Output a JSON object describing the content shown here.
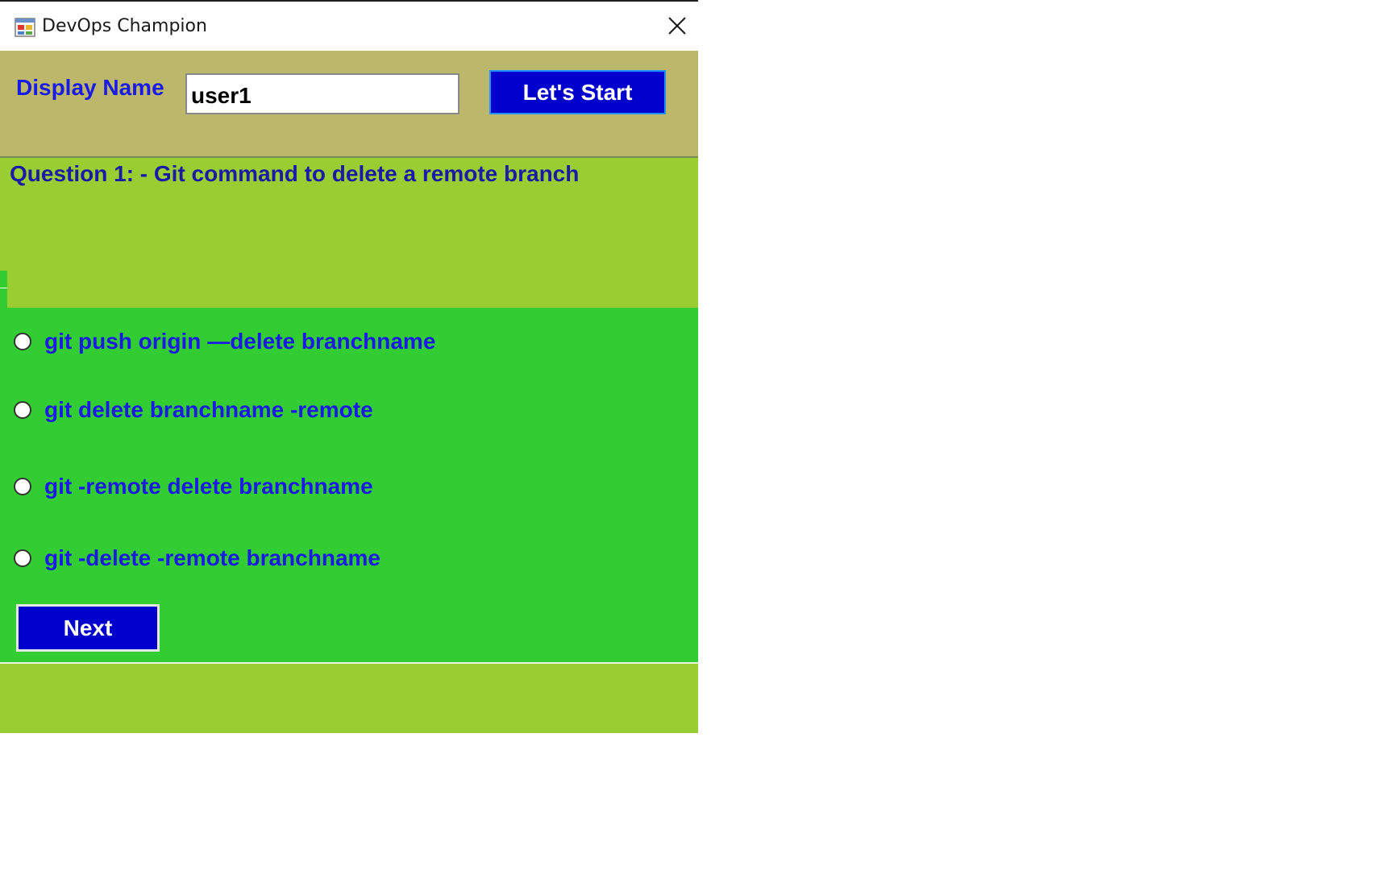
{
  "window": {
    "title": "DevOps Champion",
    "icon": "windows-form-icon",
    "close_icon": "close-icon"
  },
  "header": {
    "display_name_label": "Display Name",
    "display_name_value": "user1",
    "start_button_label": "Let's Start"
  },
  "question": {
    "text": "Question 1: - Git command to delete a remote branch"
  },
  "answers": [
    {
      "label": "git push origin —delete branchname",
      "selected": false
    },
    {
      "label": "git delete branchname -remote",
      "selected": false
    },
    {
      "label": "git -remote delete branchname",
      "selected": false
    },
    {
      "label": "git -delete -remote branchname",
      "selected": false
    }
  ],
  "navigation": {
    "next_button_label": "Next"
  },
  "colors": {
    "header_bg": "#bdb76b",
    "question_bg": "#9acd32",
    "answers_bg": "#32cd32",
    "button_bg": "#0000cd",
    "text_blue": "#1a1ae6"
  }
}
